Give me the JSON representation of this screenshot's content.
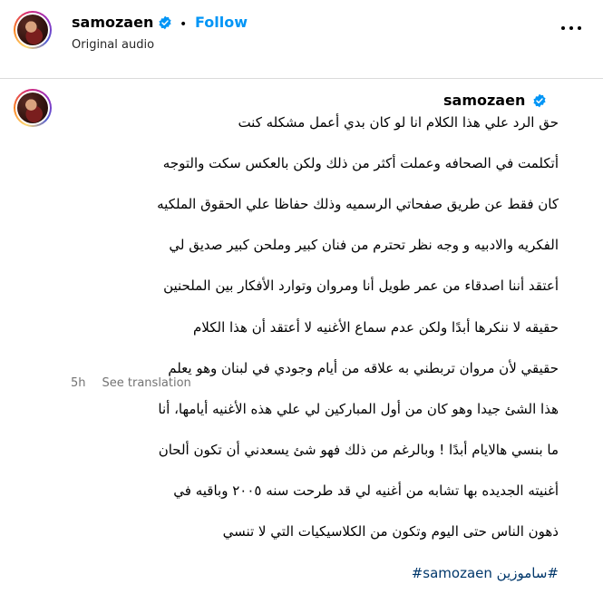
{
  "header": {
    "username": "samozaen",
    "separator": "•",
    "follow_label": "Follow",
    "audio_label": "Original audio",
    "verified_icon": "verified-badge-icon",
    "more_icon": "more-options-icon"
  },
  "caption": {
    "username": "samozaen",
    "lines": [
      "حق الرد علي هذا الكلام انا لو كان بدي أعمل مشكله كنت",
      "أتكلمت في الصحافه وعملت أكثر من ذلك ولكن بالعكس سكت والتوجه",
      "كان فقط عن طريق صفحاتي الرسميه وذلك حفاظا علي الحقوق الملكيه",
      "الفكريه والادبيه و وجه نظر تحترم من فنان كبير وملحن كبير صديق لي",
      "أعتقد أننا اصدقاء من عمر طويل أنا ومروان وتوارد الأفكار بين الملحنين",
      "حقيقه لا ننكرها أبدًا ولكن عدم سماع الأغنيه لا أعتقد أن هذا الكلام",
      "حقيقي لأن مروان تربطني به علاقه من أيام وجودي في لبنان وهو يعلم",
      "هذا الشئ جيدا وهو كان من أول المباركين لي علي هذه الأغنيه أيامها، أنا",
      "ما بنسي هالايام أبدًا ! وبالرغم من ذلك فهو شئ يسعدني أن تكون ألحان",
      "أغنيته الجديده بها تشابه من أغنيه لي قد طرحت سنه ٢٠٠٥ وباقيه في",
      "ذهون الناس حتى اليوم وتكون من الكلاسيكيات التي لا تنسي"
    ],
    "hashtags": "#ساموزين samozaen#",
    "time": "5h",
    "see_translation": "See translation"
  },
  "colors": {
    "follow": "#0095f6",
    "hashtag": "#00376b",
    "meta": "#737373",
    "divider": "#dbdbdb"
  }
}
